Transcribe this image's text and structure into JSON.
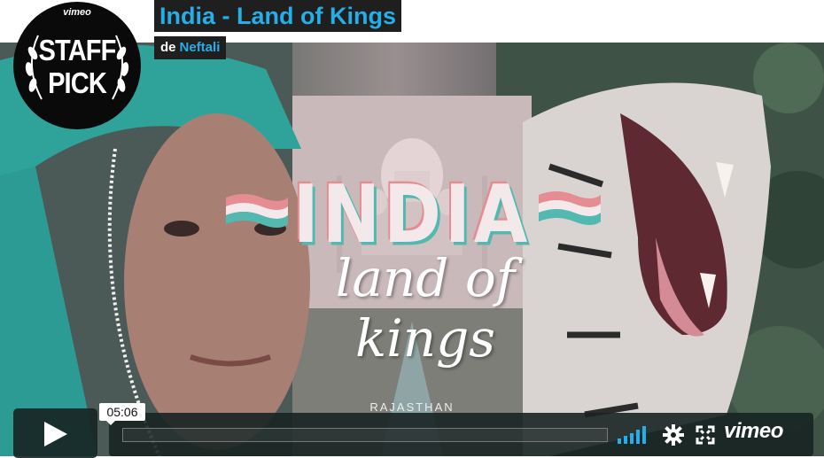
{
  "header": {
    "title": "India - Land of Kings",
    "by_prefix": "de",
    "author": "Neftali"
  },
  "badge": {
    "brand": "vimeo",
    "line1": "STAFF",
    "line2": "PICK"
  },
  "video_frame": {
    "title_big": "INDIA",
    "title_script": "land of kings",
    "place": "RAJASTHAN"
  },
  "player": {
    "time": "05:06",
    "progress": 0,
    "logo": "vimeo",
    "icons": [
      "play-icon",
      "volume-bars-icon",
      "gear-icon",
      "fullscreen-icon"
    ]
  },
  "colors": {
    "accent": "#25aee8",
    "title_bg": "#1f1f1f",
    "control_bg": "#172322",
    "teal": "#2fa39a"
  }
}
